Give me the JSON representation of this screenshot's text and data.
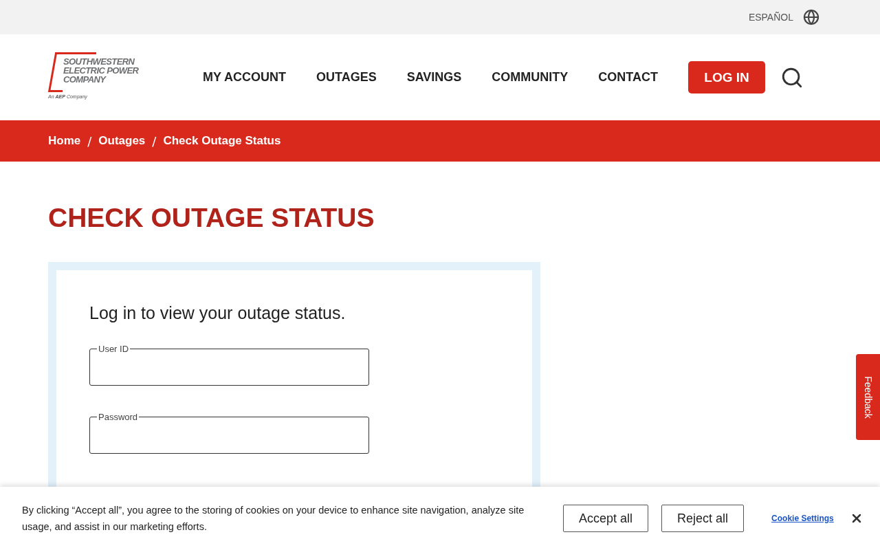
{
  "top_bar": {
    "language_link": "ESPAÑOL"
  },
  "logo": {
    "name_lines": [
      "SOUTHWESTERN",
      "ELECTRIC POWER",
      "COMPANY"
    ],
    "tagline_prefix": "An",
    "tagline_brand": "AEP",
    "tagline_suffix": "Company"
  },
  "nav": {
    "items": [
      "MY ACCOUNT",
      "OUTAGES",
      "SAVINGS",
      "COMMUNITY",
      "CONTACT"
    ],
    "login_button": "LOG IN"
  },
  "breadcrumb": {
    "separator": "/",
    "items": [
      "Home",
      "Outages",
      "Check Outage Status"
    ]
  },
  "page_title": "CHECK OUTAGE STATUS",
  "login_card": {
    "heading": "Log in to view your outage status.",
    "fields": [
      {
        "label": "User ID"
      },
      {
        "label": "Password"
      }
    ]
  },
  "feedback_tab": "Feedback",
  "cookie_banner": {
    "message": "By clicking “Accept all”, you agree to the storing of cookies on your device to enhance site navigation, analyze site usage, and assist in our marketing efforts.",
    "accept_button": "Accept all",
    "reject_button": "Reject all",
    "settings_link": "Cookie Settings"
  }
}
